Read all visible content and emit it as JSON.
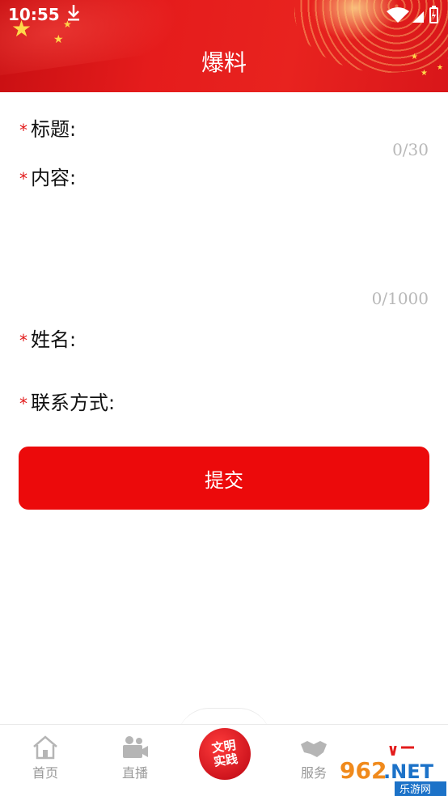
{
  "status_bar": {
    "time": "10:55"
  },
  "header": {
    "title": "爆料"
  },
  "form": {
    "required_mark": "*",
    "title_field": {
      "label": "标题:",
      "counter": "0/30",
      "value": ""
    },
    "content_field": {
      "label": "内容:",
      "counter": "0/1000",
      "value": ""
    },
    "name_field": {
      "label": "姓名:",
      "value": ""
    },
    "contact_field": {
      "label": "联系方式:",
      "value": ""
    },
    "submit_label": "提交"
  },
  "bottom_nav": {
    "items": [
      {
        "label": "首页",
        "icon": "home-icon"
      },
      {
        "label": "直播",
        "icon": "video-camera-icon"
      },
      {
        "label": "文明实践",
        "icon": "civilization-practice-badge"
      },
      {
        "label": "服务",
        "icon": "handshake-icon"
      }
    ]
  },
  "watermark": {
    "text": "962.NET",
    "subtext": "乐游网"
  },
  "colors": {
    "brand_red": "#ec0a0b",
    "header_red": "#e51c1c",
    "muted_gray": "#999999",
    "counter_gray": "#b8b8b8"
  }
}
